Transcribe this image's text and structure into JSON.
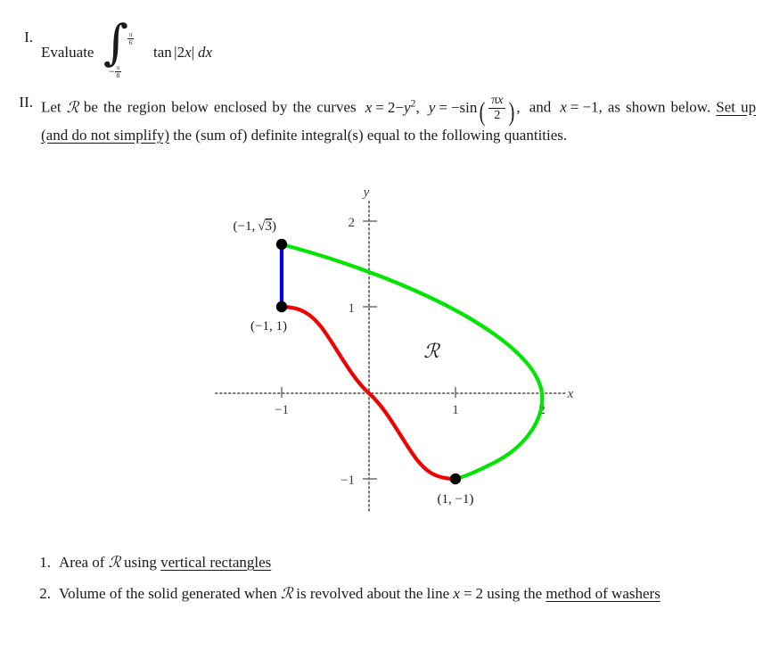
{
  "problem_1": {
    "number": "I.",
    "verb": "Evaluate",
    "integral": {
      "upper_limit_num": "π",
      "upper_limit_den": "6",
      "lower_limit_sign": "−",
      "lower_limit_num": "π",
      "lower_limit_den": "8",
      "integrand_function": "tan",
      "integrand_open": "|",
      "integrand_coefficient": "2",
      "integrand_variable": "x",
      "integrand_close": "|",
      "differential": "dx"
    }
  },
  "problem_2": {
    "number": "II.",
    "lead_text": "Let",
    "region_symbol": "R",
    "intro_text": "be the region below enclosed by the curves",
    "curve_1": {
      "lhs": "x",
      "eq": "=",
      "rhs_const": "2",
      "rhs_minus": "−",
      "rhs_var": "y",
      "rhs_exp": "2"
    },
    "curve_2": {
      "lhs": "y",
      "eq": "=",
      "minus": "−",
      "fn": "sin",
      "arg_num_pi": "π",
      "arg_num_var": "x",
      "arg_den": "2"
    },
    "conjunction": "and",
    "curve_3": {
      "lhs": "x",
      "eq": "=",
      "rhs": "−1,"
    },
    "sentence_2_part_1": "as shown below.",
    "sentence_2_underlined": "Set up (and do not simplify)",
    "sentence_2_part_2": "the (sum of) definite integral(s) equal to the following quantities."
  },
  "figure": {
    "axis_x_label": "x",
    "axis_y_label": "y",
    "region_label": "R",
    "x_ticks": [
      {
        "value": -1,
        "label": "−1"
      },
      {
        "value": 1,
        "label": "1"
      },
      {
        "value": 2,
        "label": "2"
      }
    ],
    "y_ticks": [
      {
        "value": 2,
        "label": "2"
      },
      {
        "value": 1,
        "label": "1"
      },
      {
        "value": -1,
        "label": "−1"
      }
    ],
    "points": [
      {
        "label": "(−1, √3)",
        "label_plain": "(-1, sqrt(3))",
        "x": -1,
        "y": 1.732,
        "name": "point-top-left"
      },
      {
        "label": "(−1, 1)",
        "label_plain": "(-1, 1)",
        "x": -1,
        "y": 1,
        "name": "point-mid-left"
      },
      {
        "label": "(1, −1)",
        "label_plain": "(1, -1)",
        "x": 1,
        "y": -1,
        "name": "point-bottom"
      }
    ],
    "curves": [
      {
        "name": "parabola-x-equals-2-minus-y-squared",
        "color": "#00e500",
        "equation": "x = 2 - y^2",
        "y_from": 1.732,
        "y_to": -1
      },
      {
        "name": "sine-curve-y-equals-minus-sin",
        "color": "#f00000",
        "equation": "y = -sin(pi*x/2)",
        "x_from": -1,
        "x_to": 1
      },
      {
        "name": "vertical-line-x-equals-minus-1",
        "color": "#0000ee",
        "equation": "x = -1",
        "y_from": 1,
        "y_to": 1.732
      }
    ],
    "axis_color": "#777777",
    "x_range": [
      -1.75,
      2.35
    ],
    "y_range": [
      -1.75,
      2.35
    ]
  },
  "tasks": [
    {
      "number": "1.",
      "prefix": "Area of",
      "region_symbol": "R",
      "middle": "using",
      "underlined": "vertical rectangles",
      "suffix": ""
    },
    {
      "number": "2.",
      "prefix": "Volume of the solid generated when",
      "region_symbol": "R",
      "middle": "is revolved about the line",
      "line_var": "x",
      "line_eq": "=",
      "line_value": "2",
      "after_line": "using the",
      "underlined": "method of washers",
      "suffix": ""
    }
  ]
}
